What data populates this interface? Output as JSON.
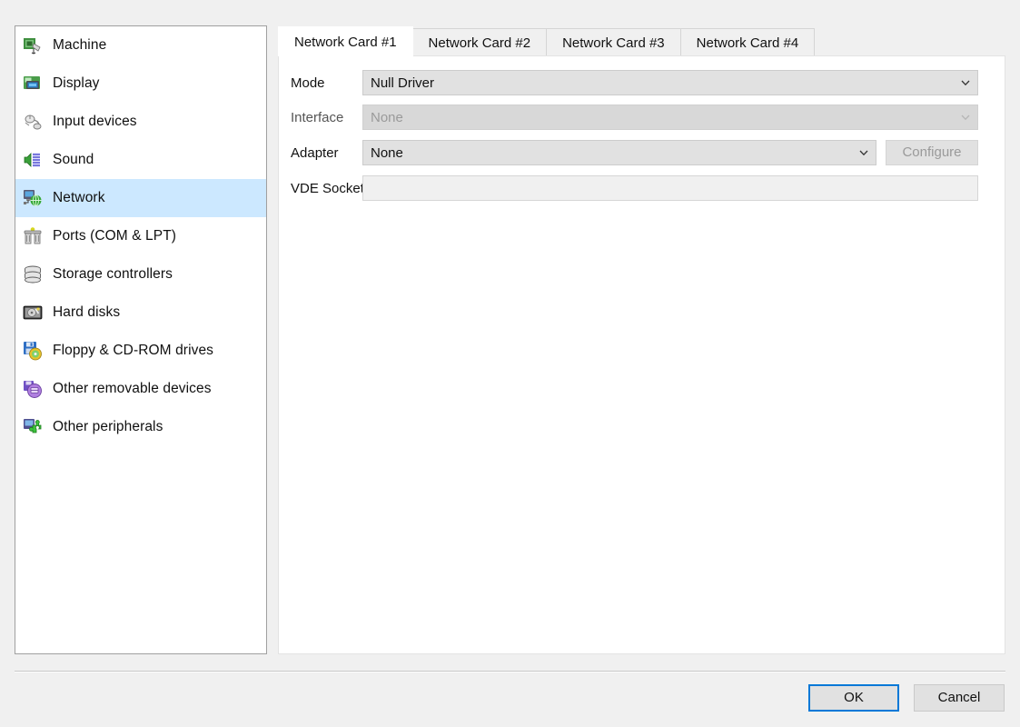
{
  "sidebar": {
    "items": [
      {
        "label": "Machine",
        "icon": "machine-icon",
        "selected": false
      },
      {
        "label": "Display",
        "icon": "display-icon",
        "selected": false
      },
      {
        "label": "Input devices",
        "icon": "input-devices-icon",
        "selected": false
      },
      {
        "label": "Sound",
        "icon": "sound-icon",
        "selected": false
      },
      {
        "label": "Network",
        "icon": "network-icon",
        "selected": true
      },
      {
        "label": "Ports (COM & LPT)",
        "icon": "ports-icon",
        "selected": false
      },
      {
        "label": "Storage controllers",
        "icon": "storage-controllers-icon",
        "selected": false
      },
      {
        "label": "Hard disks",
        "icon": "hard-disks-icon",
        "selected": false
      },
      {
        "label": "Floppy & CD-ROM drives",
        "icon": "floppy-cdrom-icon",
        "selected": false
      },
      {
        "label": "Other removable devices",
        "icon": "other-removable-icon",
        "selected": false
      },
      {
        "label": "Other peripherals",
        "icon": "other-peripherals-icon",
        "selected": false
      }
    ]
  },
  "tabs": [
    {
      "label": "Network Card #1",
      "active": true
    },
    {
      "label": "Network Card #2",
      "active": false
    },
    {
      "label": "Network Card #3",
      "active": false
    },
    {
      "label": "Network Card #4",
      "active": false
    }
  ],
  "form": {
    "mode": {
      "label": "Mode",
      "value": "Null Driver",
      "enabled": true
    },
    "interface": {
      "label": "Interface",
      "value": "None",
      "enabled": false
    },
    "adapter": {
      "label": "Adapter",
      "value": "None",
      "enabled": true
    },
    "configure": {
      "label": "Configure",
      "enabled": false
    },
    "vde": {
      "label": "VDE Socket",
      "value": "",
      "placeholder": ""
    }
  },
  "footer": {
    "ok_label": "OK",
    "cancel_label": "Cancel"
  },
  "colors": {
    "selection": "#cce8ff",
    "focus": "#0078d7",
    "window": "#f0f0f0",
    "panel": "#ffffff"
  }
}
